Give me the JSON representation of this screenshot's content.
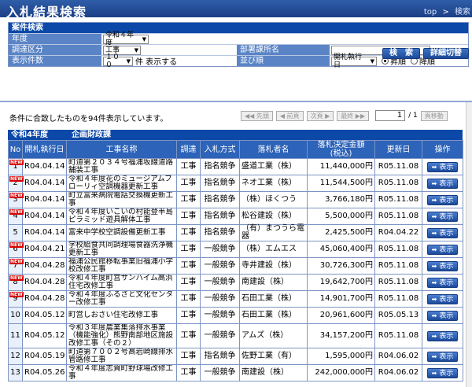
{
  "header": {
    "title": "入札結果検索",
    "links": [
      "top",
      ">",
      "検索"
    ]
  },
  "search": {
    "section_title": "案件検索",
    "fields": {
      "year_label": "年度",
      "year_value": "令和４年度",
      "category_label": "調達区分",
      "category_value": "工事",
      "dept_label": "部署課所名",
      "dept_value": "",
      "count_label": "表示件数",
      "count_value": "１００",
      "count_suffix": "件 表示する",
      "sort_label": "並び順",
      "sort_value": "開札執行日",
      "asc_label": "昇順",
      "desc_label": "降順"
    },
    "search_button": "検　索",
    "detail_button": "詳細切替"
  },
  "results": {
    "summary": "条件に合致したものを94件表示しています。",
    "pager": {
      "first": "◀◀ 先頭",
      "prev": "◀ 前頁",
      "next": "次頁 ▶",
      "last": "最終 ▶▶",
      "current": "1",
      "total": "/ 1",
      "jump": "頁移動"
    },
    "section": {
      "year": "令和4年度",
      "dept": "企画財政課"
    },
    "columns": [
      "No",
      "開札執行日",
      "工事名称",
      "調達",
      "入札方式",
      "落札者名",
      "落札決定金額\n(税込)",
      "更新日",
      "操作"
    ],
    "show_label": "表示",
    "rows": [
      {
        "no": "1",
        "new": true,
        "date": "R04.04.14",
        "name": "町道第２０３４号福浦坂線道路舗装工事",
        "type": "工事",
        "method": "指名競争",
        "winner": "盛道工業（株）",
        "amount": "11,440,000円",
        "updated": "R05.11.08"
      },
      {
        "no": "2",
        "new": true,
        "date": "R04.04.14",
        "name": "令和４年度花のミュージアムフローリィ空調機器更新工事",
        "type": "工事",
        "method": "指名競争",
        "winner": "ネオ工業（株）",
        "amount": "11,544,500円",
        "updated": "R05.11.08"
      },
      {
        "no": "3",
        "new": true,
        "date": "R04.04.14",
        "name": "町立富来病院電話交換機更新工事",
        "type": "工事",
        "method": "指名競争",
        "winner": "（株）ほくつう",
        "amount": "3,766,180円",
        "updated": "R05.11.08"
      },
      {
        "no": "4",
        "new": true,
        "date": "R04.04.14",
        "name": "令和４年度いこいの村能登半島ピラミッド遊具解体工事",
        "type": "工事",
        "method": "指名競争",
        "winner": "松谷建設（株）",
        "amount": "5,500,000円",
        "updated": "R05.11.08"
      },
      {
        "no": "5",
        "new": false,
        "date": "R04.04.14",
        "name": "富来中学校空調設備更新工事",
        "type": "工事",
        "method": "指名競争",
        "winner": "（有）まつうら電器",
        "amount": "2,425,500円",
        "updated": "R04.04.22"
      },
      {
        "no": "6",
        "new": true,
        "date": "R04.04.21",
        "name": "学校給食共同調理場食器洗浄機更新工事",
        "type": "工事",
        "method": "一般競争",
        "winner": "（株）エムエス",
        "amount": "45,060,400円",
        "updated": "R05.11.08"
      },
      {
        "no": "7",
        "new": true,
        "date": "R04.04.28",
        "name": "福浦公民館移転事業旧福浦小学校改修工事",
        "type": "工事",
        "method": "一般競争",
        "winner": "寺井建設（株）",
        "amount": "30,726,300円",
        "updated": "R05.11.08"
      },
      {
        "no": "8",
        "new": true,
        "date": "R04.04.28",
        "name": "令和４年度町営サンハイム高浜住宅改修工事",
        "type": "工事",
        "method": "一般競争",
        "winner": "南建設（株）",
        "amount": "19,642,700円",
        "updated": "R05.11.08"
      },
      {
        "no": "9",
        "new": true,
        "date": "R04.04.28",
        "name": "令和４年度ふるさと文化センター改修工事",
        "type": "工事",
        "method": "一般競争",
        "winner": "石田工業（株）",
        "amount": "14,901,700円",
        "updated": "R05.11.08"
      },
      {
        "no": "10",
        "new": false,
        "date": "R04.05.12",
        "name": "町営しおさい住宅改修工事",
        "type": "工事",
        "method": "一般競争",
        "winner": "石田工業（株）",
        "amount": "20,961,600円",
        "updated": "R05.05.13"
      },
      {
        "no": "11",
        "new": false,
        "date": "R04.05.12",
        "name": "令和３年度農業集落排水事業（機能強化）熊野南部地区施設改修工事（その２）",
        "type": "工事",
        "method": "一般競争",
        "winner": "アムズ（株）",
        "amount": "34,157,200円",
        "updated": "R05.11.08"
      },
      {
        "no": "12",
        "new": false,
        "date": "R04.05.19",
        "name": "町道第７００２号高岩崎線排水管路修工事",
        "type": "工事",
        "method": "指名競争",
        "winner": "佐野工業（有）",
        "amount": "1,595,000円",
        "updated": "R04.06.02"
      },
      {
        "no": "13",
        "new": false,
        "date": "R04.05.26",
        "name": "令和４年度志賀町野球場改修工事",
        "type": "工事",
        "method": "一般競争",
        "winner": "南建設（株）",
        "amount": "242,000,000円",
        "updated": "R04.06.02"
      }
    ]
  }
}
